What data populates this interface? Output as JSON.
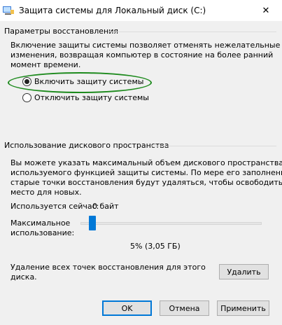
{
  "window": {
    "title": "Защита системы для Локальный диск (C:)",
    "close_glyph": "✕"
  },
  "restore": {
    "group_label": "Параметры восстановления",
    "description": [
      "Включение защиты системы позволяет отменять нежелательные",
      "изменения, возвращая компьютер в состояние на более ранний",
      "момент времени."
    ],
    "option_on": "Включить защиту системы",
    "option_off": "Отключить защиту системы",
    "selected": "on"
  },
  "disk_usage": {
    "group_label": "Использование дискового пространства",
    "description": [
      "Вы можете указать максимальный объем дискового пространства,",
      "используемого функцией защиты системы. По мере его заполнения",
      "старые точки восстановления будут удаляться, чтобы освободить",
      "место для новых."
    ],
    "current_label": "Используется сейчас:",
    "current_value": "0 байт",
    "max_label_line1": "Максимальное",
    "max_label_line2": "использование:",
    "slider_percent": 5,
    "slider_value_text": "5% (3,05 ГБ)",
    "delete_text_line1": "Удаление всех точек восстановления для этого",
    "delete_text_line2": "диска.",
    "delete_button": "Удалить"
  },
  "buttons": {
    "ok": "OK",
    "cancel": "Отмена",
    "apply": "Применить"
  },
  "colors": {
    "accent": "#0078d7",
    "annotation": "#1d8a1d"
  }
}
